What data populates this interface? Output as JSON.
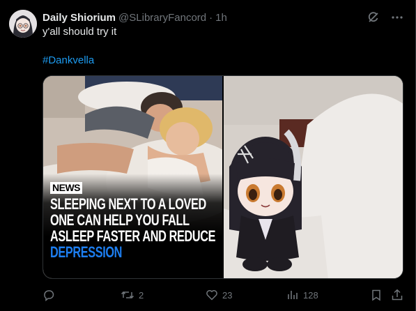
{
  "tweet": {
    "display_name": "Daily Shiorium",
    "handle": "@SLibraryFancord",
    "separator": "·",
    "time": "1h",
    "text": "y'all should try it",
    "hashtag": "#Dankvella"
  },
  "media": {
    "left": {
      "badge": "NEWS",
      "headline_lines": [
        "SLEEPING NEXT TO A LOVED",
        "ONE CAN HELP YOU FALL",
        "ASLEEP FASTER AND REDUCE"
      ],
      "headline_highlight": "DEPRESSION"
    }
  },
  "actions": {
    "reply_icon": "reply-icon",
    "retweet_count": "2",
    "like_count": "23",
    "views_count": "128"
  },
  "colors": {
    "background": "#000000",
    "text": "#e7e9ea",
    "muted": "#71767b",
    "link": "#1d9bf0",
    "headline_blue": "#1d7ef0"
  }
}
